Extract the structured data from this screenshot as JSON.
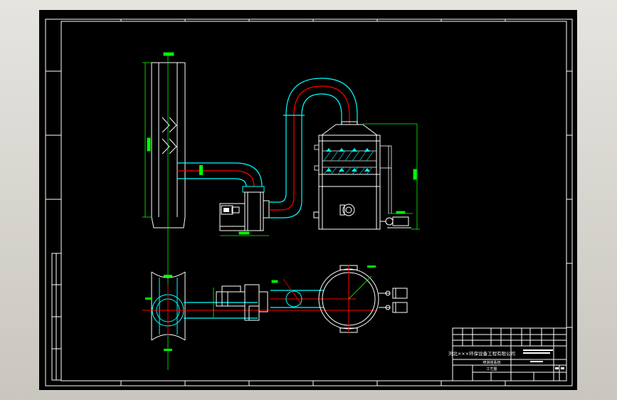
{
  "colors": {
    "paper": "#000000",
    "border": "#ffffff",
    "duct_outline": "#00ffff",
    "centerline": "#ff0000",
    "dimension": "#00ff00",
    "equipment": "#ffffff",
    "hatch": "#00cccc",
    "spray": "#00ffff"
  },
  "title_block": {
    "company": "河北×××环保设备工程有限公司",
    "drawing_title": "喷淋塔系统",
    "drawing_subtitle": "工艺图"
  },
  "icons": [
    "spray-nozzle-icon",
    "fan-motor-icon",
    "pump-icon",
    "manhole-icon"
  ]
}
